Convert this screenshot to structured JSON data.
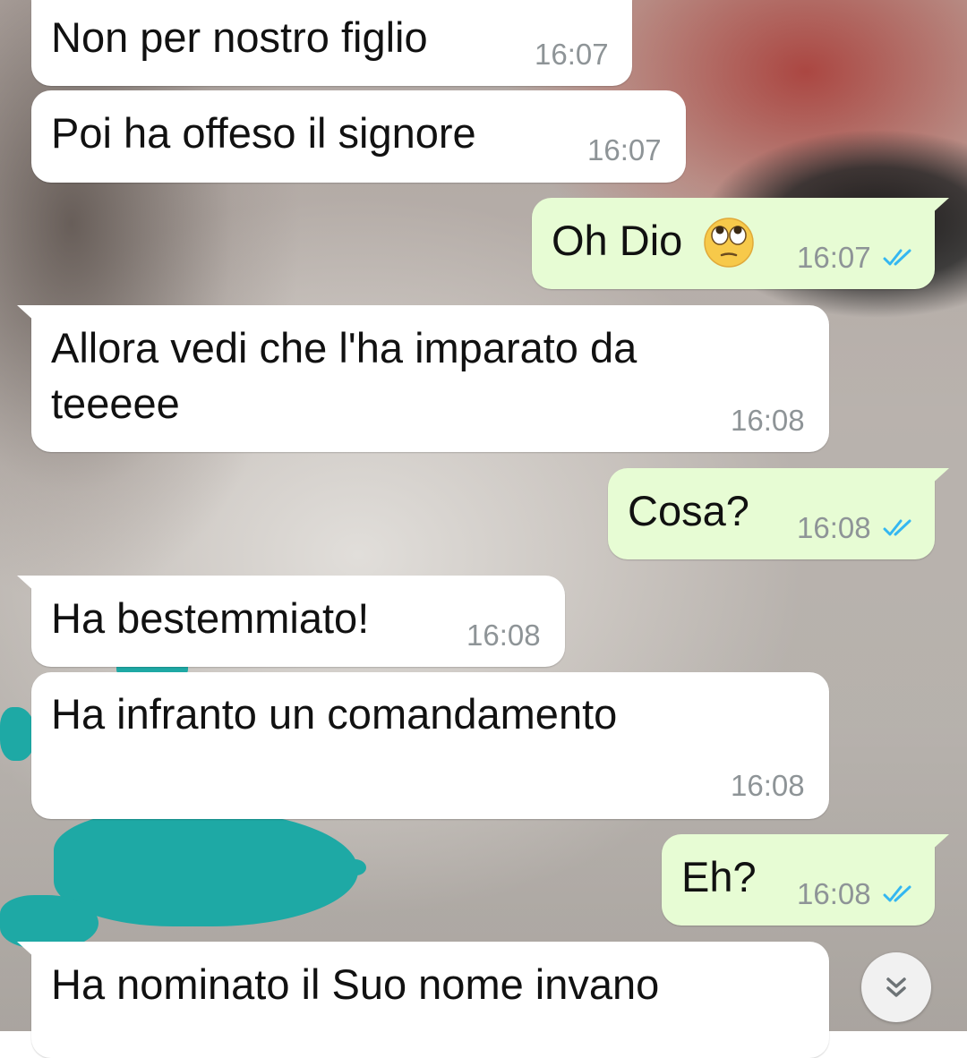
{
  "conversation": {
    "messages": [
      {
        "direction": "incoming",
        "text": "Non per nostro figlio",
        "time": "16:07"
      },
      {
        "direction": "incoming",
        "text": "Poi ha offeso il signore",
        "time": "16:07"
      },
      {
        "direction": "outgoing",
        "text": "Oh Dio",
        "emoji": "face-with-rolling-eyes-emoji",
        "time": "16:07",
        "status": "read"
      },
      {
        "direction": "incoming",
        "text_line1": "Allora vedi che l'ha imparato da",
        "text_line2": "teeeee",
        "time": "16:08"
      },
      {
        "direction": "outgoing",
        "text": "Cosa?",
        "time": "16:08",
        "status": "read"
      },
      {
        "direction": "incoming",
        "text": "Ha bestemmiato!",
        "time": "16:08"
      },
      {
        "direction": "incoming",
        "text": "Ha infranto un comandamento",
        "time": "16:08"
      },
      {
        "direction": "outgoing",
        "text": "Eh?",
        "time": "16:08",
        "status": "read"
      },
      {
        "direction": "incoming",
        "text": "Ha nominato il Suo nome invano",
        "time": ""
      }
    ]
  },
  "controls": {
    "scroll_to_bottom_icon": "double-chevron-down-icon"
  },
  "colors": {
    "incoming_bubble": "#ffffff",
    "outgoing_bubble": "#e7fcd4",
    "read_ticks": "#34b7f1",
    "timestamp": "#8e9497"
  }
}
